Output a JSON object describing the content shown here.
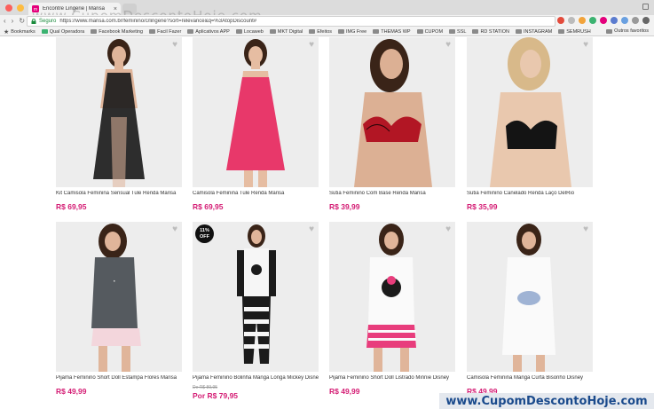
{
  "browser": {
    "tab_title": "Encontre Lingerie | Marisa",
    "tab_close": "×",
    "secure_label": "Seguro",
    "url": "https://www.marisa.com.br/feminino/c/lingerie?sort=relevance&q=%3AtopDiscount#",
    "bookmarks": [
      "Bookmarks",
      "Qual Operadora",
      "Facebook Marketing",
      "Facil Fazer",
      "Aplicativos APP",
      "Locaweb",
      "MKT Digital",
      "Efeitos",
      "IMG Free",
      "THEMAS WP",
      "CUPOM",
      "SSL",
      "RD STATION",
      "INSTAGRAM",
      "SEMRUSH"
    ],
    "other_bookmarks": "Outros favoritos"
  },
  "watermarks": {
    "top": "www.CupomDescontoHoje.com",
    "bottom": "www.CupomDescontoHoje.com"
  },
  "products": [
    {
      "name": "Kit Camisola Feminina Sensual Tule Renda Marisa",
      "price": "R$ 69,95"
    },
    {
      "name": "Camisola Feminina Tule Renda Marisa",
      "price": "R$ 69,95"
    },
    {
      "name": "Sutiã Feminino Com Base Renda Marisa",
      "price": "R$ 39,99"
    },
    {
      "name": "Sutiã Feminino Canelado Renda Laço DelRio",
      "price": "R$ 35,99"
    },
    {
      "name": "Pijama Feminino Short Doll Estampa Flores Marisa",
      "price": "R$ 49,99"
    },
    {
      "name": "Pijama Feminino Bolinha Manga Longa Mickey Disney",
      "old_price": "De R$ 89,95",
      "price": "Por R$ 79,95",
      "badge_pct": "11%",
      "badge_off": "OFF"
    },
    {
      "name": "Pijama Feminino Short Doll Listrado Minnie Disney",
      "price": "R$ 49,99"
    },
    {
      "name": "Camisola Feminina Manga Curta Bisonho Disney",
      "price": "R$ 49,99"
    }
  ],
  "colors": {
    "price": "#d41c74",
    "accent": "#e4007c"
  },
  "icons": {
    "favorite": "heart-icon",
    "heart_glyph": "♥"
  }
}
